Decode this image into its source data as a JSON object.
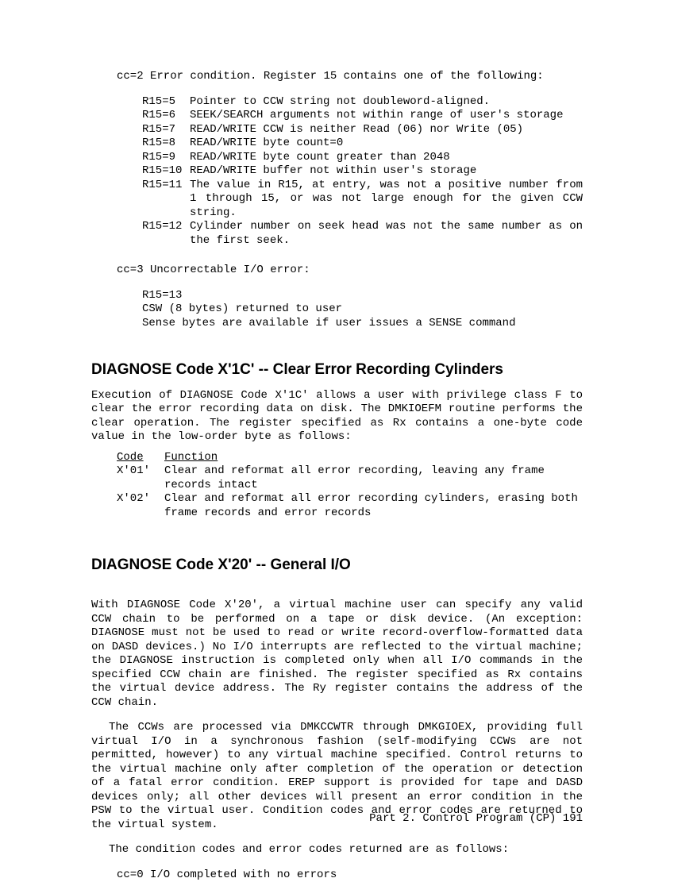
{
  "cc2": {
    "label": "cc=2 Error condition.  Register 15 contains one of the following:",
    "rows": [
      {
        "k": "R15=5",
        "v": "Pointer to CCW string not doubleword-aligned."
      },
      {
        "k": "R15=6",
        "v": "SEEK/SEARCH arguments not within range of user's storage"
      },
      {
        "k": "R15=7",
        "v": "READ/WRITE CCW is neither Read (06) nor Write (05)"
      },
      {
        "k": "R15=8",
        "v": "READ/WRITE byte count=0"
      },
      {
        "k": "R15=9",
        "v": "READ/WRITE byte count greater than 2048"
      },
      {
        "k": "R15=10",
        "v": "READ/WRITE buffer not within user's storage"
      },
      {
        "k": "R15=11",
        "v": "The value in R15, at entry, was not a positive number from 1 through 15, or was not large enough for the given CCW string."
      },
      {
        "k": "R15=12",
        "v": "Cylinder number on seek head was not the same number as on the first seek."
      }
    ]
  },
  "cc3": {
    "label": "cc=3 Uncorrectable I/O error:",
    "lines": [
      "R15=13",
      "CSW (8 bytes) returned to user",
      "Sense bytes are available if user issues a SENSE command"
    ]
  },
  "sec1": {
    "heading": "DIAGNOSE Code X'1C' -- Clear Error Recording Cylinders",
    "para": "Execution of DIAGNOSE Code X'1C' allows a user with privilege class F to clear the error recording data on disk.  The DMKIOEFM routine performs the clear operation.  The register specified as Rx contains a one-byte code value in the low-order byte as follows:",
    "codeHeader": {
      "k": "Code",
      "v": "Function"
    },
    "codes": [
      {
        "k": "X'01'",
        "v": "Clear and reformat all error recording, leaving any frame records intact"
      },
      {
        "k": "X'02'",
        "v": "Clear and reformat all error recording cylinders, erasing both frame records and error records"
      }
    ]
  },
  "sec2": {
    "heading": "DIAGNOSE Code X'20' -- General I/O",
    "para1": "With DIAGNOSE Code X'20', a virtual machine user can specify any valid CCW chain to be performed on a tape or disk device.  (An exception: DIAGNOSE must not be used to read or write record-overflow-formatted data on DASD devices.)  No I/O interrupts are reflected to the virtual machine; the DIAGNOSE instruction is completed only when all I/O commands in the specified CCW chain are finished.  The register specified as Rx contains the virtual device address.  The Ry register contains the address of the CCW chain.",
    "para2": "The CCWs are processed via DMKCCWTR through DMKGIOEX, providing full virtual I/O in a synchronous fashion (self-modifying CCWs are not permitted, however) to any virtual machine specified.  Control returns to the virtual machine only after completion of the operation or detection of a fatal error condition.  EREP support is provided for tape and DASD devices only; all other devices will present an error condition in the PSW to the virtual user.  Condition codes and error codes are returned to the virtual system.",
    "para3": "The condition codes and error codes returned are as follows:",
    "cc0": "cc=0 I/O completed with no errors"
  },
  "footer": "Part 2. Control Program (CP)  191"
}
